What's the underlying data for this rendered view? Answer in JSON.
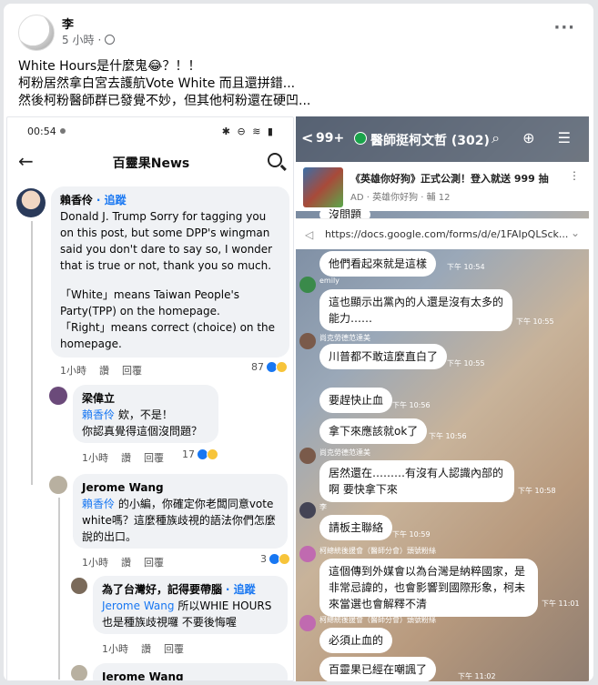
{
  "post": {
    "author": "李",
    "time": "5 小時",
    "sep": "·",
    "lines": [
      "White Hours是什麼鬼😂？！！",
      "柯粉居然拿白宮去護航Vote White 而且還拼錯...",
      "然後柯粉醫師群已發覺不妙，但其他柯粉還在硬凹..."
    ],
    "more": "···"
  },
  "left": {
    "status_time": "00:54",
    "status_icons": "✱ ⊖ ≋ ▮",
    "back": "←",
    "title": "百靈果News",
    "comments": [
      {
        "name": "賴香伶",
        "follow": "· 追蹤",
        "text1": "Donald J. Trump Sorry for tagging you on this post, but some DPP's wingman said you don't dare to say so, I wonder that is true or not, thank you so much.",
        "text2": "「White」means Taiwan People's Party(TPP) on the homepage.",
        "text3": "「Right」means correct (choice) on the homepage.",
        "time": "1小時",
        "read": "讚",
        "reply": "回覆",
        "count": "87"
      },
      {
        "name": "梁偉立",
        "mention": "賴香伶",
        "text": " 欸，不是！",
        "text2": "你認真覺得這個沒問題？",
        "time": "1小時",
        "read": "讚",
        "reply": "回覆",
        "count": "17"
      },
      {
        "name": "Jerome Wang",
        "mention": "賴香伶",
        "text": " 的小編，你確定你老闆同意vote white嗎？這麼種族歧視的語法你們怎麼說的出口。",
        "time": "1小時",
        "read": "讚",
        "reply": "回覆",
        "count": "3"
      },
      {
        "name": "為了台灣好，記得要帶腦",
        "follow": "· 追蹤",
        "mention": "Jerome Wang",
        "text": " 所以WHIE HOURS也是種族歧視囉 不要後悔喔",
        "time": "1小時",
        "read": "讚",
        "reply": "回覆"
      },
      {
        "name": "Jerome Wang"
      }
    ]
  },
  "right": {
    "back": "<",
    "num": "99+",
    "title": "醫師挺柯文哲 (302)",
    "icons": "⌕ ⊕ ☰",
    "ad_title": "《英雄你好狗》正式公測！登入就送 999 抽",
    "ad_sub": "AD · 英雄你好狗 · 輔 12",
    "ad_more": "⋮",
    "link": "https://docs.google.com/forms/d/e/1FAIpQLSck...",
    "link_icon": "◁",
    "link_close": "⌄",
    "top_partial": "沒問題",
    "msgs": [
      {
        "text": "他們看起來就是這樣",
        "time": "下午 10:54"
      },
      {
        "name": "emily",
        "text": "這也顯示出黨內的人還是沒有太多的能力……",
        "time": "下午 10:55"
      },
      {
        "name": "尚克勞德范達美",
        "text": "川普都不敢這麼直白了",
        "time": "下午 10:55"
      },
      {
        "text": "要趕快止血",
        "time": "下午 10:56"
      },
      {
        "text": "拿下來應該就ok了",
        "time": "下午 10:56"
      },
      {
        "name": "尚克勞德范達美",
        "text": "居然還在………有沒有人認識內部的啊  要快拿下來",
        "time": "下午 10:58"
      },
      {
        "name": "李",
        "text": "請板主聯絡",
        "time": "下午 10:59"
      },
      {
        "name": "柯總統後援會（醫師分會）頭號粉絲",
        "text": "這個傳到外媒會以為台灣是納粹國家，是非常忌諱的，也會影響到國際形象，柯未來當選也會解釋不清",
        "time": "下午 11:01"
      },
      {
        "name": "柯總統後援會（醫師分會）頭號粉絲",
        "text": "必須止血的",
        "time": ""
      },
      {
        "text": "百靈果已經在嘲諷了",
        "time": "下午 11:02"
      }
    ]
  }
}
